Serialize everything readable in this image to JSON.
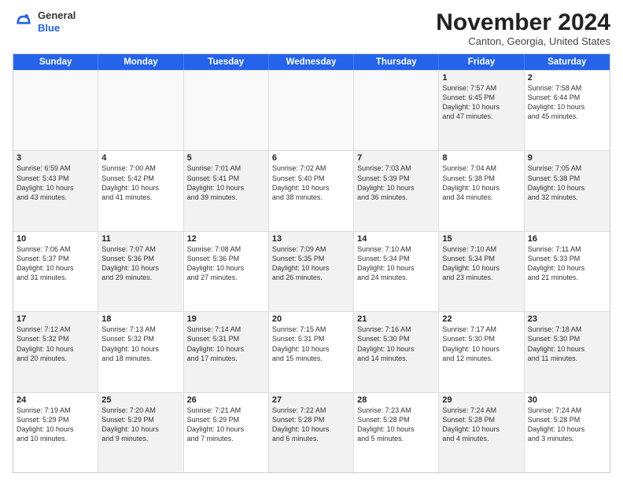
{
  "header": {
    "logo_general": "General",
    "logo_blue": "Blue",
    "month_title": "November 2024",
    "subtitle": "Canton, Georgia, United States"
  },
  "days_of_week": [
    "Sunday",
    "Monday",
    "Tuesday",
    "Wednesday",
    "Thursday",
    "Friday",
    "Saturday"
  ],
  "weeks": [
    [
      {
        "day": "",
        "info": "",
        "empty": true
      },
      {
        "day": "",
        "info": "",
        "empty": true
      },
      {
        "day": "",
        "info": "",
        "empty": true
      },
      {
        "day": "",
        "info": "",
        "empty": true
      },
      {
        "day": "",
        "info": "",
        "empty": true
      },
      {
        "day": "1",
        "info": "Sunrise: 7:57 AM\nSunset: 6:45 PM\nDaylight: 10 hours\nand 47 minutes.",
        "shaded": true
      },
      {
        "day": "2",
        "info": "Sunrise: 7:58 AM\nSunset: 6:44 PM\nDaylight: 10 hours\nand 45 minutes.",
        "shaded": false
      }
    ],
    [
      {
        "day": "3",
        "info": "Sunrise: 6:59 AM\nSunset: 5:43 PM\nDaylight: 10 hours\nand 43 minutes.",
        "shaded": true
      },
      {
        "day": "4",
        "info": "Sunrise: 7:00 AM\nSunset: 5:42 PM\nDaylight: 10 hours\nand 41 minutes.",
        "shaded": false
      },
      {
        "day": "5",
        "info": "Sunrise: 7:01 AM\nSunset: 5:41 PM\nDaylight: 10 hours\nand 39 minutes.",
        "shaded": true
      },
      {
        "day": "6",
        "info": "Sunrise: 7:02 AM\nSunset: 5:40 PM\nDaylight: 10 hours\nand 38 minutes.",
        "shaded": false
      },
      {
        "day": "7",
        "info": "Sunrise: 7:03 AM\nSunset: 5:39 PM\nDaylight: 10 hours\nand 36 minutes.",
        "shaded": true
      },
      {
        "day": "8",
        "info": "Sunrise: 7:04 AM\nSunset: 5:38 PM\nDaylight: 10 hours\nand 34 minutes.",
        "shaded": false
      },
      {
        "day": "9",
        "info": "Sunrise: 7:05 AM\nSunset: 5:38 PM\nDaylight: 10 hours\nand 32 minutes.",
        "shaded": true
      }
    ],
    [
      {
        "day": "10",
        "info": "Sunrise: 7:06 AM\nSunset: 5:37 PM\nDaylight: 10 hours\nand 31 minutes.",
        "shaded": false
      },
      {
        "day": "11",
        "info": "Sunrise: 7:07 AM\nSunset: 5:36 PM\nDaylight: 10 hours\nand 29 minutes.",
        "shaded": true
      },
      {
        "day": "12",
        "info": "Sunrise: 7:08 AM\nSunset: 5:36 PM\nDaylight: 10 hours\nand 27 minutes.",
        "shaded": false
      },
      {
        "day": "13",
        "info": "Sunrise: 7:09 AM\nSunset: 5:35 PM\nDaylight: 10 hours\nand 26 minutes.",
        "shaded": true
      },
      {
        "day": "14",
        "info": "Sunrise: 7:10 AM\nSunset: 5:34 PM\nDaylight: 10 hours\nand 24 minutes.",
        "shaded": false
      },
      {
        "day": "15",
        "info": "Sunrise: 7:10 AM\nSunset: 5:34 PM\nDaylight: 10 hours\nand 23 minutes.",
        "shaded": true
      },
      {
        "day": "16",
        "info": "Sunrise: 7:11 AM\nSunset: 5:33 PM\nDaylight: 10 hours\nand 21 minutes.",
        "shaded": false
      }
    ],
    [
      {
        "day": "17",
        "info": "Sunrise: 7:12 AM\nSunset: 5:32 PM\nDaylight: 10 hours\nand 20 minutes.",
        "shaded": true
      },
      {
        "day": "18",
        "info": "Sunrise: 7:13 AM\nSunset: 5:32 PM\nDaylight: 10 hours\nand 18 minutes.",
        "shaded": false
      },
      {
        "day": "19",
        "info": "Sunrise: 7:14 AM\nSunset: 5:31 PM\nDaylight: 10 hours\nand 17 minutes.",
        "shaded": true
      },
      {
        "day": "20",
        "info": "Sunrise: 7:15 AM\nSunset: 5:31 PM\nDaylight: 10 hours\nand 15 minutes.",
        "shaded": false
      },
      {
        "day": "21",
        "info": "Sunrise: 7:16 AM\nSunset: 5:30 PM\nDaylight: 10 hours\nand 14 minutes.",
        "shaded": true
      },
      {
        "day": "22",
        "info": "Sunrise: 7:17 AM\nSunset: 5:30 PM\nDaylight: 10 hours\nand 12 minutes.",
        "shaded": false
      },
      {
        "day": "23",
        "info": "Sunrise: 7:18 AM\nSunset: 5:30 PM\nDaylight: 10 hours\nand 11 minutes.",
        "shaded": true
      }
    ],
    [
      {
        "day": "24",
        "info": "Sunrise: 7:19 AM\nSunset: 5:29 PM\nDaylight: 10 hours\nand 10 minutes.",
        "shaded": false
      },
      {
        "day": "25",
        "info": "Sunrise: 7:20 AM\nSunset: 5:29 PM\nDaylight: 10 hours\nand 9 minutes.",
        "shaded": true
      },
      {
        "day": "26",
        "info": "Sunrise: 7:21 AM\nSunset: 5:29 PM\nDaylight: 10 hours\nand 7 minutes.",
        "shaded": false
      },
      {
        "day": "27",
        "info": "Sunrise: 7:22 AM\nSunset: 5:28 PM\nDaylight: 10 hours\nand 6 minutes.",
        "shaded": true
      },
      {
        "day": "28",
        "info": "Sunrise: 7:23 AM\nSunset: 5:28 PM\nDaylight: 10 hours\nand 5 minutes.",
        "shaded": false
      },
      {
        "day": "29",
        "info": "Sunrise: 7:24 AM\nSunset: 5:28 PM\nDaylight: 10 hours\nand 4 minutes.",
        "shaded": true
      },
      {
        "day": "30",
        "info": "Sunrise: 7:24 AM\nSunset: 5:28 PM\nDaylight: 10 hours\nand 3 minutes.",
        "shaded": false
      }
    ]
  ]
}
